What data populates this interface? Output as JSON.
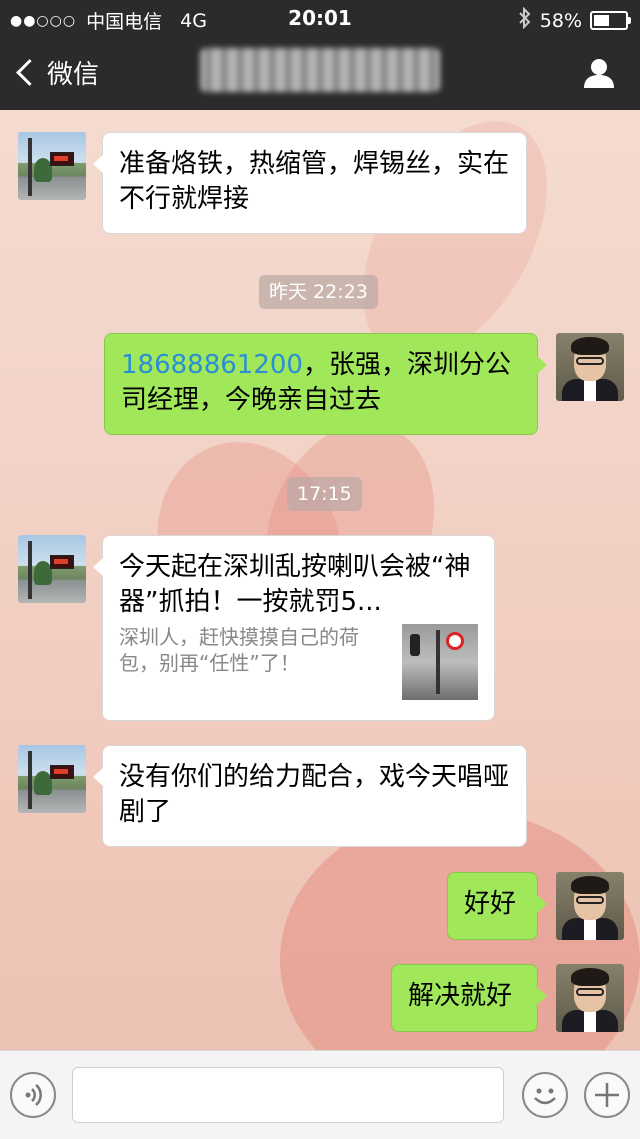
{
  "status_bar": {
    "signal": "●●○○○",
    "carrier": "中国电信",
    "network": "4G",
    "time": "20:01",
    "battery_percent": "58%",
    "battery_level": 0.58
  },
  "nav": {
    "back_label": "微信"
  },
  "messages": [
    {
      "side": "left",
      "text": "准备烙铁，热缩管，焊锡丝，实在不行就焊接"
    },
    {
      "timestamp": "昨天 22:23"
    },
    {
      "side": "right",
      "phone": "18688861200",
      "text": "，张强，深圳分公司经理，今晚亲自过去"
    },
    {
      "timestamp": "17:15"
    },
    {
      "side": "left",
      "card_title": "今天起在深圳乱按喇叭会被“神器”抓拍！一按就罚5...",
      "card_desc": "深圳人，赶快摸摸自己的荷包，别再“任性”了！"
    },
    {
      "side": "left",
      "text": "没有你们的给力配合，戏今天唱哑剧了"
    },
    {
      "side": "right",
      "text": "好好"
    },
    {
      "side": "right",
      "text": "解决就好"
    }
  ],
  "input_bar": {
    "voice_icon": "voice-icon",
    "emoji_icon": "emoji-icon",
    "plus_icon": "plus-icon"
  }
}
